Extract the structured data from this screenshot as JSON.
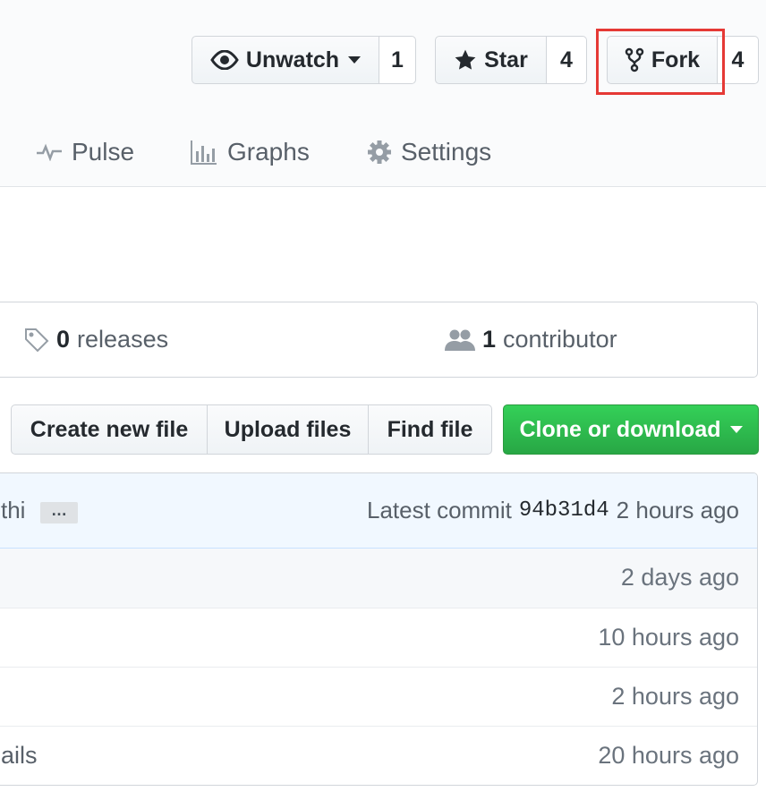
{
  "repo_actions": {
    "unwatch": {
      "label": "Unwatch",
      "count": "1",
      "icon": "eye-icon"
    },
    "star": {
      "label": "Star",
      "count": "4",
      "icon": "star-icon"
    },
    "fork": {
      "label": "Fork",
      "count": "4",
      "icon": "fork-icon"
    }
  },
  "tabs": [
    {
      "label": "Pulse",
      "icon": "pulse-icon"
    },
    {
      "label": "Graphs",
      "icon": "graph-icon"
    },
    {
      "label": "Settings",
      "icon": "gear-icon"
    }
  ],
  "summary": {
    "releases": {
      "count": "0",
      "label": "releases",
      "icon": "tag-icon"
    },
    "contributors": {
      "count": "1",
      "label": "contributor",
      "icon": "people-icon"
    }
  },
  "file_actions": {
    "create": "Create new file",
    "upload": "Upload files",
    "find": "Find file",
    "clone": "Clone or download"
  },
  "commit_bar": {
    "message_fragment": "thi",
    "ellipsis": "…",
    "latest_label": "Latest commit",
    "sha": "94b31d4",
    "time": "2 hours ago"
  },
  "files": [
    {
      "name": "",
      "age": "2 days ago"
    },
    {
      "name": "",
      "age": "10 hours ago"
    },
    {
      "name": "",
      "age": "2 hours ago"
    },
    {
      "name": "ails",
      "age": "20 hours ago"
    }
  ],
  "colors": {
    "accent_green": "#28a745",
    "highlight_red": "#e53935",
    "commit_bar_bg": "#f1f8ff"
  }
}
